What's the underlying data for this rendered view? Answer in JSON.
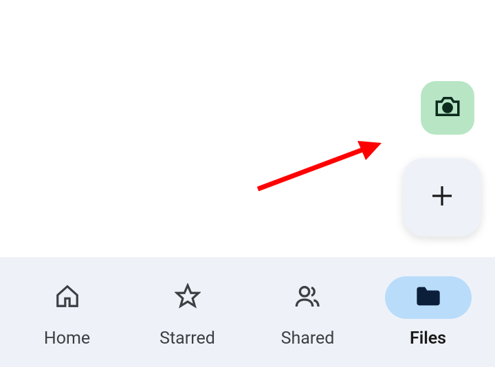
{
  "fab": {
    "camera_icon": "camera",
    "plus_icon": "plus"
  },
  "nav": {
    "items": [
      {
        "label": "Home",
        "icon": "home",
        "active": false
      },
      {
        "label": "Starred",
        "icon": "star",
        "active": false
      },
      {
        "label": "Shared",
        "icon": "people",
        "active": false
      },
      {
        "label": "Files",
        "icon": "folder",
        "active": true
      }
    ]
  },
  "annotation": {
    "type": "arrow",
    "color": "#ff0000"
  }
}
